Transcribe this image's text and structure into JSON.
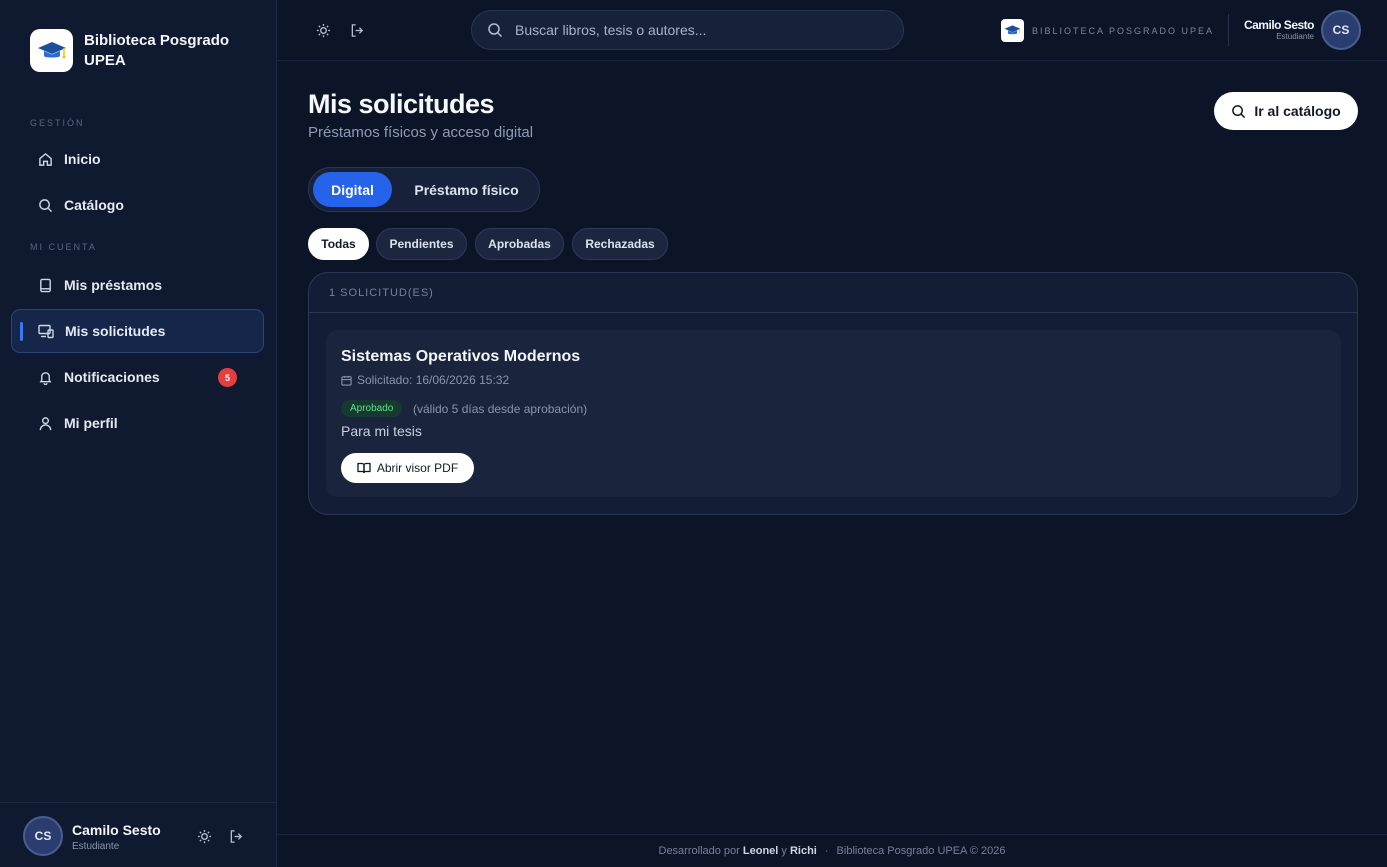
{
  "brand": {
    "name": "Biblioteca Posgrado UPEA",
    "top_label": "BIBLIOTECA POSGRADO UPEA"
  },
  "sidebar": {
    "section_management": "GESTIÓN",
    "section_account": "MI CUENTA",
    "items": [
      {
        "label": "Inicio",
        "icon": "home-icon"
      },
      {
        "label": "Catálogo",
        "icon": "search-icon"
      },
      {
        "label": "Mis préstamos",
        "icon": "book-icon"
      },
      {
        "label": "Mis solicitudes",
        "icon": "devices-icon",
        "active": true
      },
      {
        "label": "Notificaciones",
        "icon": "bell-icon",
        "badge": "5"
      },
      {
        "label": "Mi perfil",
        "icon": "user-icon"
      }
    ]
  },
  "user": {
    "name": "Camilo Sesto",
    "role": "Estudiante",
    "initials": "CS"
  },
  "search": {
    "placeholder": "Buscar libros, tesis o autores..."
  },
  "page": {
    "title": "Mis solicitudes",
    "subtitle": "Préstamos físicos y acceso digital",
    "catalog_button": "Ir al catálogo"
  },
  "segments": {
    "digital": "Digital",
    "physical": "Préstamo físico"
  },
  "filters": [
    "Todas",
    "Pendientes",
    "Aprobadas",
    "Rechazadas"
  ],
  "results": {
    "count_label": "1 SOLICITUD(ES)",
    "items": [
      {
        "title": "Sistemas Operativos Modernos",
        "requested": "Solicitado: 16/06/2026 15:32",
        "status": "Aprobado",
        "status_note": "(válido 5 días desde aprobación)",
        "reason": "Para mi tesis",
        "action": "Abrir visor PDF"
      }
    ]
  },
  "footer": {
    "prefix": "Desarrollado por",
    "author1": "Leonel",
    "conj": "y",
    "author2": "Richi",
    "dot": "·",
    "copyright": "Biblioteca Posgrado UPEA © 2026"
  },
  "colors": {
    "accent": "#2563eb",
    "badge": "#e53e3e",
    "approved": "#5ee08e"
  }
}
